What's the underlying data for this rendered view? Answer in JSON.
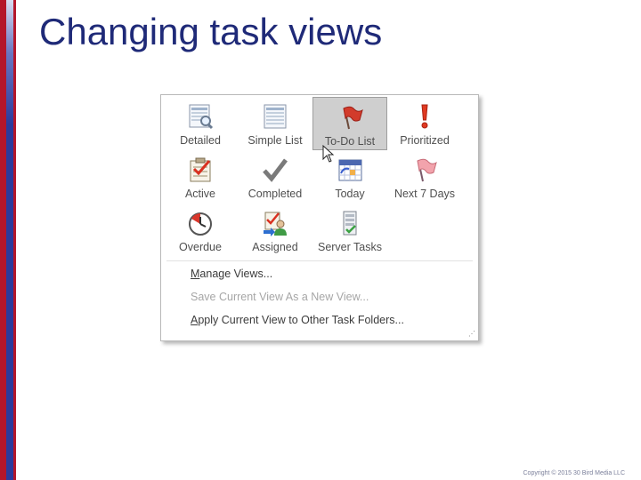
{
  "slide": {
    "title": "Changing task views",
    "copyright": "Copyright © 2015 30 Bird Media LLC"
  },
  "gallery": {
    "views": [
      {
        "label": "Detailed",
        "icon": "detailed-view-icon",
        "selected": false
      },
      {
        "label": "Simple List",
        "icon": "simple-list-icon",
        "selected": false
      },
      {
        "label": "To-Do List",
        "icon": "red-flag-icon",
        "selected": true
      },
      {
        "label": "Prioritized",
        "icon": "exclamation-icon",
        "selected": false
      },
      {
        "label": "Active",
        "icon": "active-tasks-icon",
        "selected": false
      },
      {
        "label": "Completed",
        "icon": "checkmark-icon",
        "selected": false
      },
      {
        "label": "Today",
        "icon": "calendar-today-icon",
        "selected": false
      },
      {
        "label": "Next 7 Days",
        "icon": "pink-flag-icon",
        "selected": false
      },
      {
        "label": "Overdue",
        "icon": "overdue-clock-icon",
        "selected": false
      },
      {
        "label": "Assigned",
        "icon": "assigned-tasks-icon",
        "selected": false
      },
      {
        "label": "Server Tasks",
        "icon": "server-tasks-icon",
        "selected": false
      }
    ]
  },
  "menu": {
    "manage_prefix": "M",
    "manage_rest": "anage Views...",
    "save_as_new": "Save Current View As a New View...",
    "apply_prefix": "A",
    "apply_rest": "pply Current View to Other Task Folders..."
  },
  "colors": {
    "sidebar_red": "#b4162a",
    "sidebar_blue": "#2b3a9c",
    "title_blue": "#1f2a78",
    "selected_bg": "#cfcfcf"
  }
}
